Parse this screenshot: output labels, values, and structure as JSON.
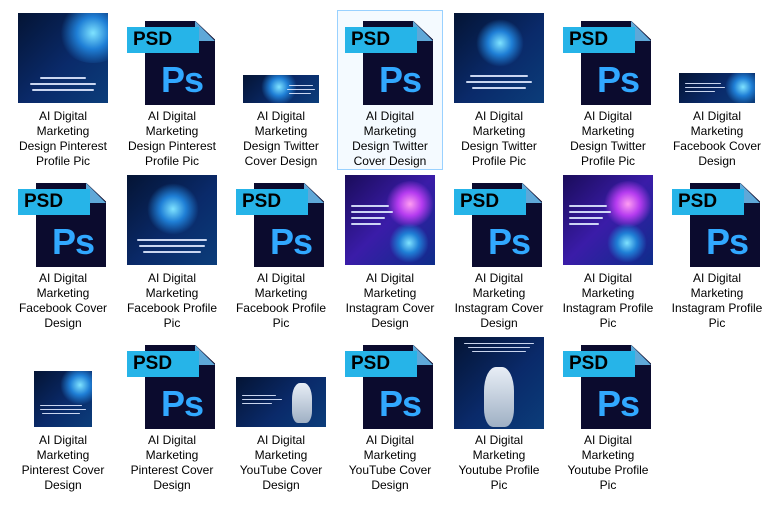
{
  "files": [
    {
      "label": "AI Digital\nMarketing\nDesign Pinterest\nProfile Pic",
      "type": "image",
      "selected": false
    },
    {
      "label": "AI Digital\nMarketing\nDesign Pinterest\nProfile Pic",
      "type": "psd",
      "selected": false
    },
    {
      "label": "AI Digital\nMarketing\nDesign Twitter\nCover Design",
      "type": "image",
      "selected": false
    },
    {
      "label": "AI Digital\nMarketing\nDesign Twitter\nCover Design",
      "type": "psd",
      "selected": true
    },
    {
      "label": "AI Digital\nMarketing\nDesign Twitter\nProfile Pic",
      "type": "image",
      "selected": false
    },
    {
      "label": "AI Digital\nMarketing\nDesign Twitter\nProfile Pic",
      "type": "psd",
      "selected": false
    },
    {
      "label": "AI Digital\nMarketing\nFacebook Cover\nDesign",
      "type": "image",
      "selected": false
    },
    {
      "label": "AI Digital\nMarketing\nFacebook Cover\nDesign",
      "type": "psd",
      "selected": false
    },
    {
      "label": "AI Digital\nMarketing\nFacebook Profile\nPic",
      "type": "image",
      "selected": false
    },
    {
      "label": "AI Digital\nMarketing\nFacebook Profile\nPic",
      "type": "psd",
      "selected": false
    },
    {
      "label": "AI Digital\nMarketing\nInstagram Cover\nDesign",
      "type": "image",
      "selected": false
    },
    {
      "label": "AI Digital\nMarketing\nInstagram Cover\nDesign",
      "type": "psd",
      "selected": false
    },
    {
      "label": "AI Digital\nMarketing\nInstagram Profile\nPic",
      "type": "image",
      "selected": false
    },
    {
      "label": "AI Digital\nMarketing\nInstagram Profile\nPic",
      "type": "psd",
      "selected": false
    },
    {
      "label": "AI Digital\nMarketing\nPinterest Cover\nDesign",
      "type": "image",
      "selected": false
    },
    {
      "label": "AI Digital\nMarketing\nPinterest Cover\nDesign",
      "type": "psd",
      "selected": false
    },
    {
      "label": "AI Digital\nMarketing\nYouTube Cover\nDesign",
      "type": "image",
      "selected": false
    },
    {
      "label": "AI Digital\nMarketing\nYouTube Cover\nDesign",
      "type": "psd",
      "selected": false
    },
    {
      "label": "AI Digital\nMarketing\nYoutube Profile\nPic",
      "type": "image",
      "selected": false
    },
    {
      "label": "AI Digital\nMarketing\nYoutube Profile\nPic",
      "type": "psd",
      "selected": false
    }
  ],
  "psd_icon": {
    "badge_text": "PSD",
    "glyph_text": "Ps",
    "icon": "photoshop-file-icon"
  },
  "colors": {
    "selection_border": "#99d1ff",
    "psd_badge": "#26b4e8",
    "ps_glyph": "#31a8ff",
    "doc_dark": "#0b0b2e"
  }
}
